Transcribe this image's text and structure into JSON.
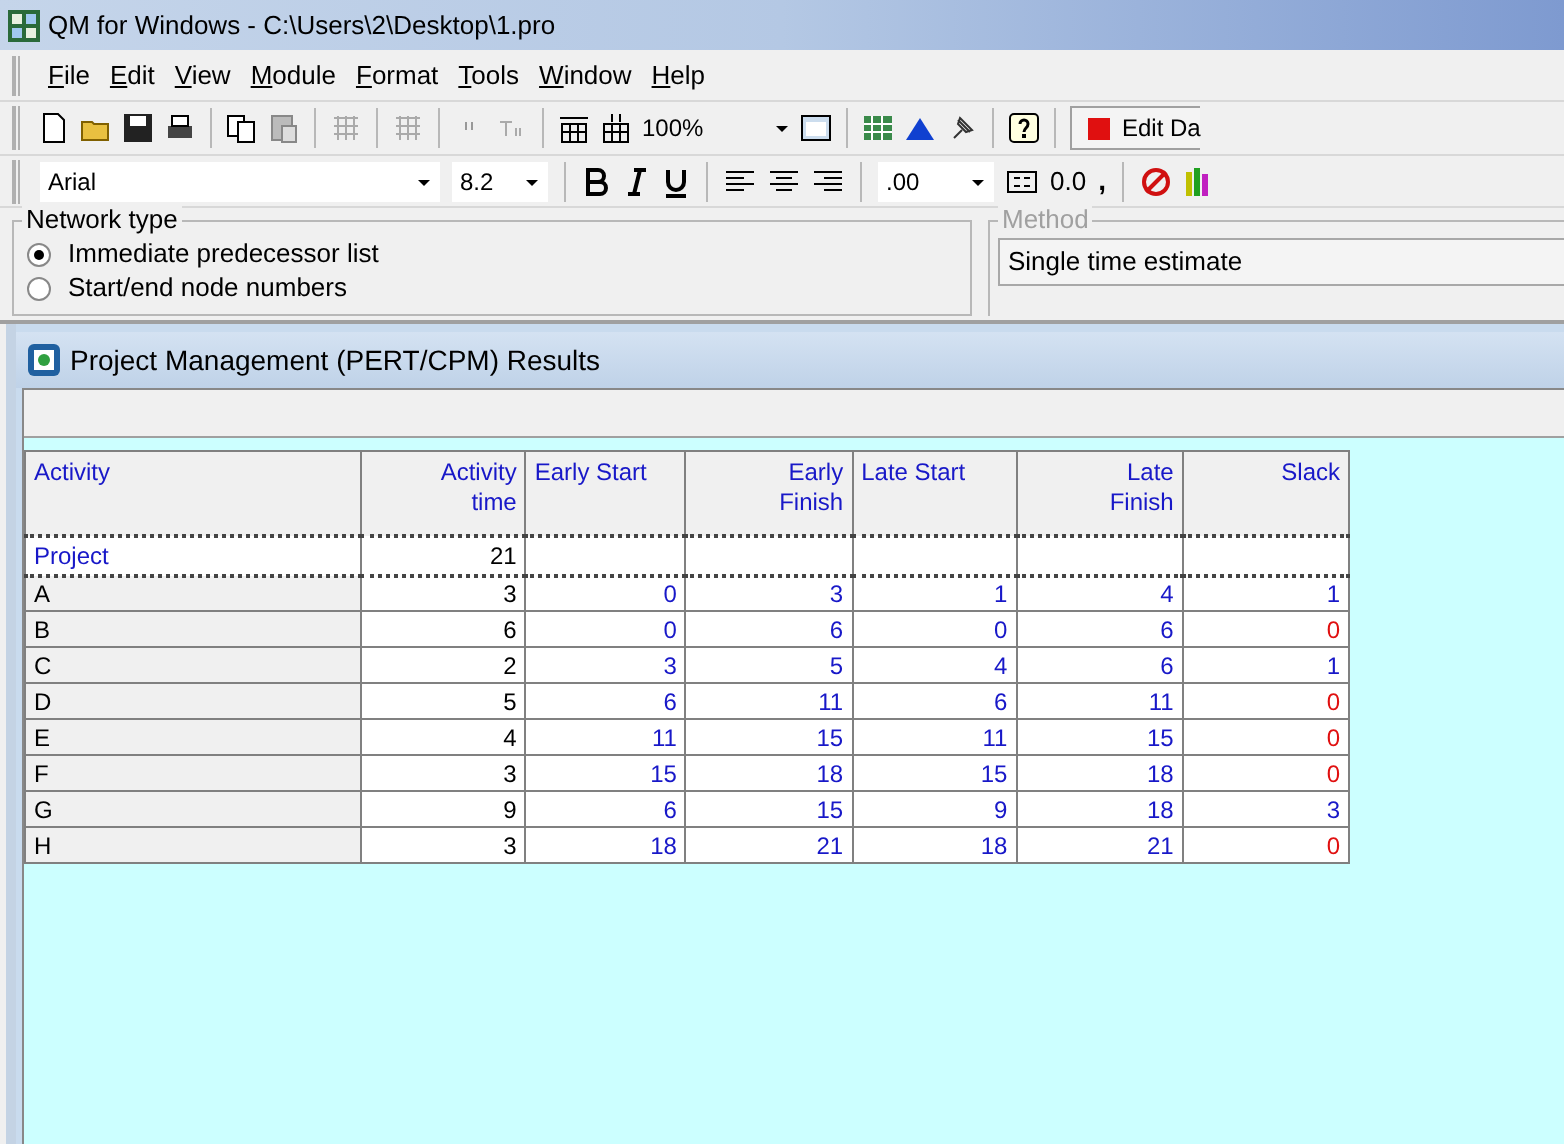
{
  "window": {
    "title": "QM for Windows - C:\\Users\\2\\Desktop\\1.pro"
  },
  "menu": [
    {
      "label": "File"
    },
    {
      "label": "Edit"
    },
    {
      "label": "View"
    },
    {
      "label": "Module"
    },
    {
      "label": "Format"
    },
    {
      "label": "Tools"
    },
    {
      "label": "Window"
    },
    {
      "label": "Help"
    }
  ],
  "toolbar": {
    "zoom": "100%",
    "edit_button": "Edit Da"
  },
  "format_bar": {
    "font": "Arial",
    "size": "8.2",
    "decimals": ".00",
    "fix_dec": "0.0",
    "comma": ","
  },
  "network_type": {
    "title": "Network type",
    "options": [
      {
        "label": "Immediate predecessor list",
        "selected": true
      },
      {
        "label": "Start/end node numbers",
        "selected": false
      }
    ]
  },
  "method": {
    "title": "Method",
    "value": "Single time estimate"
  },
  "results": {
    "title": "Project Management (PERT/CPM) Results",
    "columns": [
      "Activity",
      "Activity time",
      "Early Start",
      "Early Finish",
      "Late Start",
      "Late Finish",
      "Slack"
    ],
    "project": {
      "cells": [
        "Project",
        "21"
      ]
    },
    "rows": [
      {
        "cells": [
          "A",
          "3",
          "0",
          "3",
          "1",
          "4",
          "1"
        ],
        "critical": false
      },
      {
        "cells": [
          "B",
          "6",
          "0",
          "6",
          "0",
          "6",
          "0"
        ],
        "critical": true
      },
      {
        "cells": [
          "C",
          "2",
          "3",
          "5",
          "4",
          "6",
          "1"
        ],
        "critical": false
      },
      {
        "cells": [
          "D",
          "5",
          "6",
          "11",
          "6",
          "11",
          "0"
        ],
        "critical": true
      },
      {
        "cells": [
          "E",
          "4",
          "11",
          "15",
          "11",
          "15",
          "0"
        ],
        "critical": true
      },
      {
        "cells": [
          "F",
          "3",
          "15",
          "18",
          "15",
          "18",
          "0"
        ],
        "critical": true
      },
      {
        "cells": [
          "G",
          "9",
          "6",
          "15",
          "9",
          "18",
          "3"
        ],
        "critical": false
      },
      {
        "cells": [
          "H",
          "3",
          "18",
          "21",
          "18",
          "21",
          "0"
        ],
        "critical": true
      }
    ]
  }
}
